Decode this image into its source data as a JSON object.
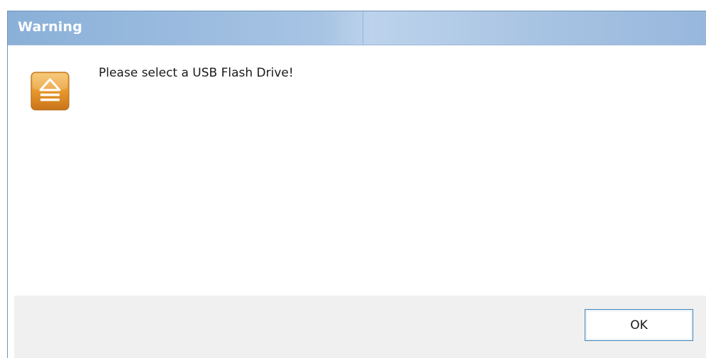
{
  "dialog": {
    "title": "Warning",
    "message": "Please select a USB Flash Drive!",
    "icon": "usb-eject-icon",
    "ok_label": "OK"
  },
  "colors": {
    "title_bar": "#a7c4e4",
    "title_text": "#ffffff",
    "icon_orange": "#e6962a",
    "footer_bg": "#f0f0f0",
    "button_border": "#3c7fb1"
  }
}
